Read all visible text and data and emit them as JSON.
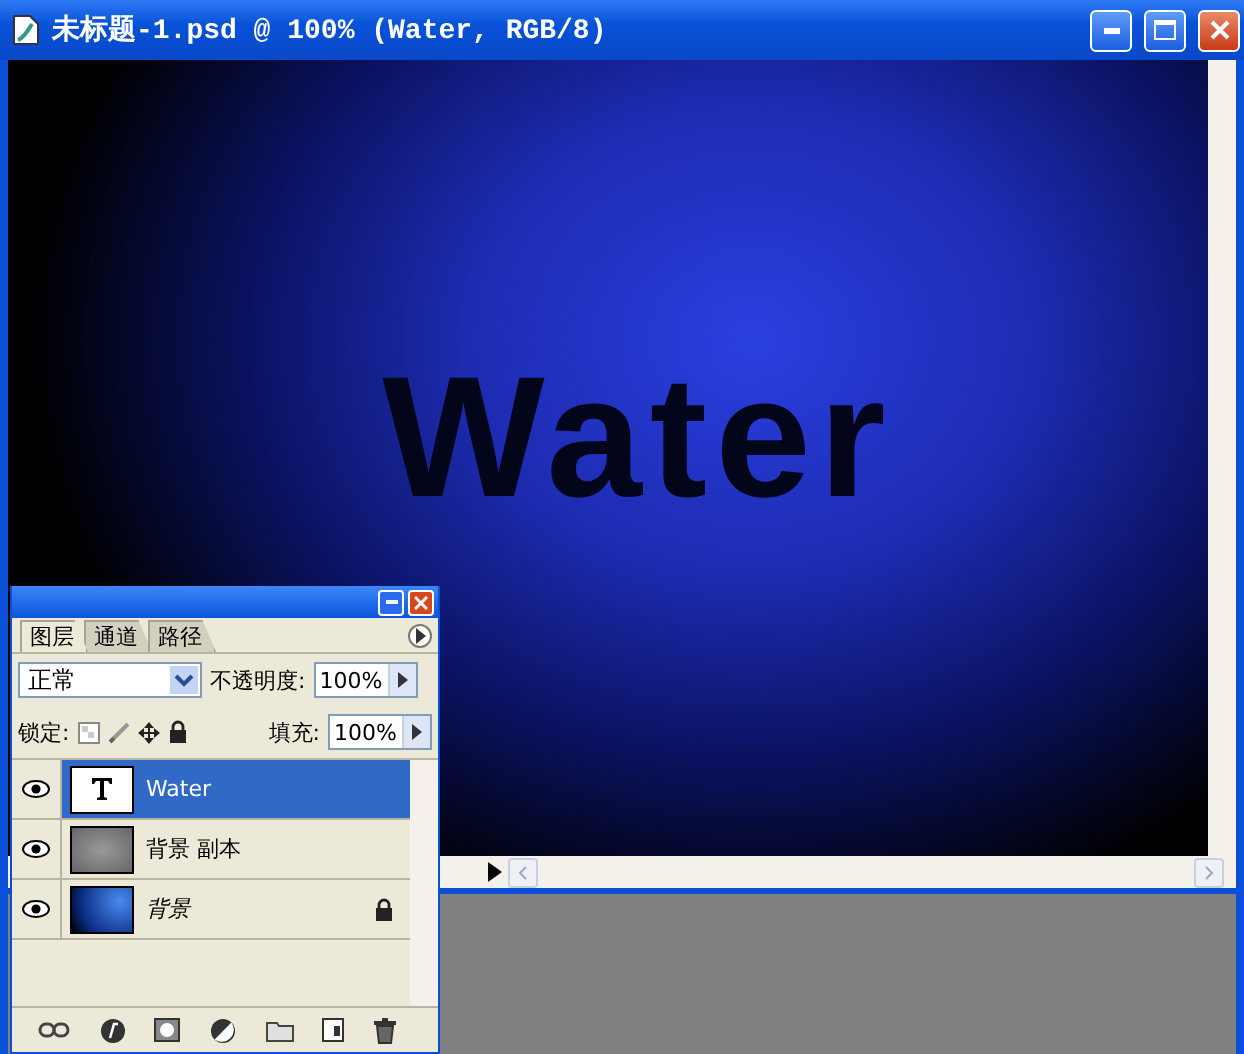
{
  "document": {
    "title": "未标题-1.psd @ 100% (Water, RGB/8)",
    "canvas_text": "Water"
  },
  "layers_panel": {
    "tabs": [
      {
        "label": "图层",
        "selected": true
      },
      {
        "label": "通道",
        "selected": false
      },
      {
        "label": "路径",
        "selected": false
      }
    ],
    "blend_mode": "正常",
    "opacity_label": "不透明度:",
    "opacity": "100%",
    "lock_label": "锁定:",
    "fill_label": "填充:",
    "fill": "100%",
    "layers": [
      {
        "name": "Water",
        "kind": "text",
        "selected": true,
        "visible": true,
        "locked": false
      },
      {
        "name": "背景 副本",
        "kind": "image",
        "selected": false,
        "visible": true,
        "locked": false
      },
      {
        "name": "背景",
        "kind": "background",
        "selected": false,
        "visible": true,
        "locked": true
      }
    ]
  }
}
